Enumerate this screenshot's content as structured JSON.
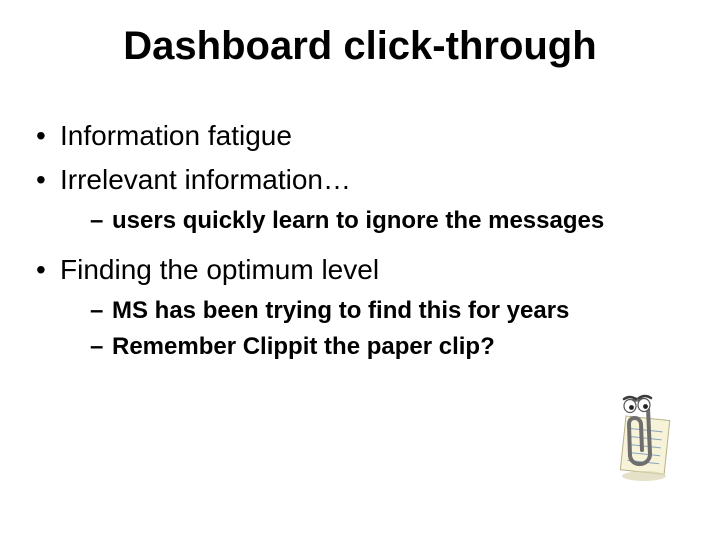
{
  "title": "Dashboard click-through",
  "bullets": {
    "b0": "Information fatigue",
    "b1": "Irrelevant information…",
    "b1_sub0": "users quickly learn to ignore the messages",
    "b2": "Finding the optimum level",
    "b2_sub0": "MS has been trying to find this for years",
    "b2_sub1": "Remember Clippit the paper clip?"
  }
}
